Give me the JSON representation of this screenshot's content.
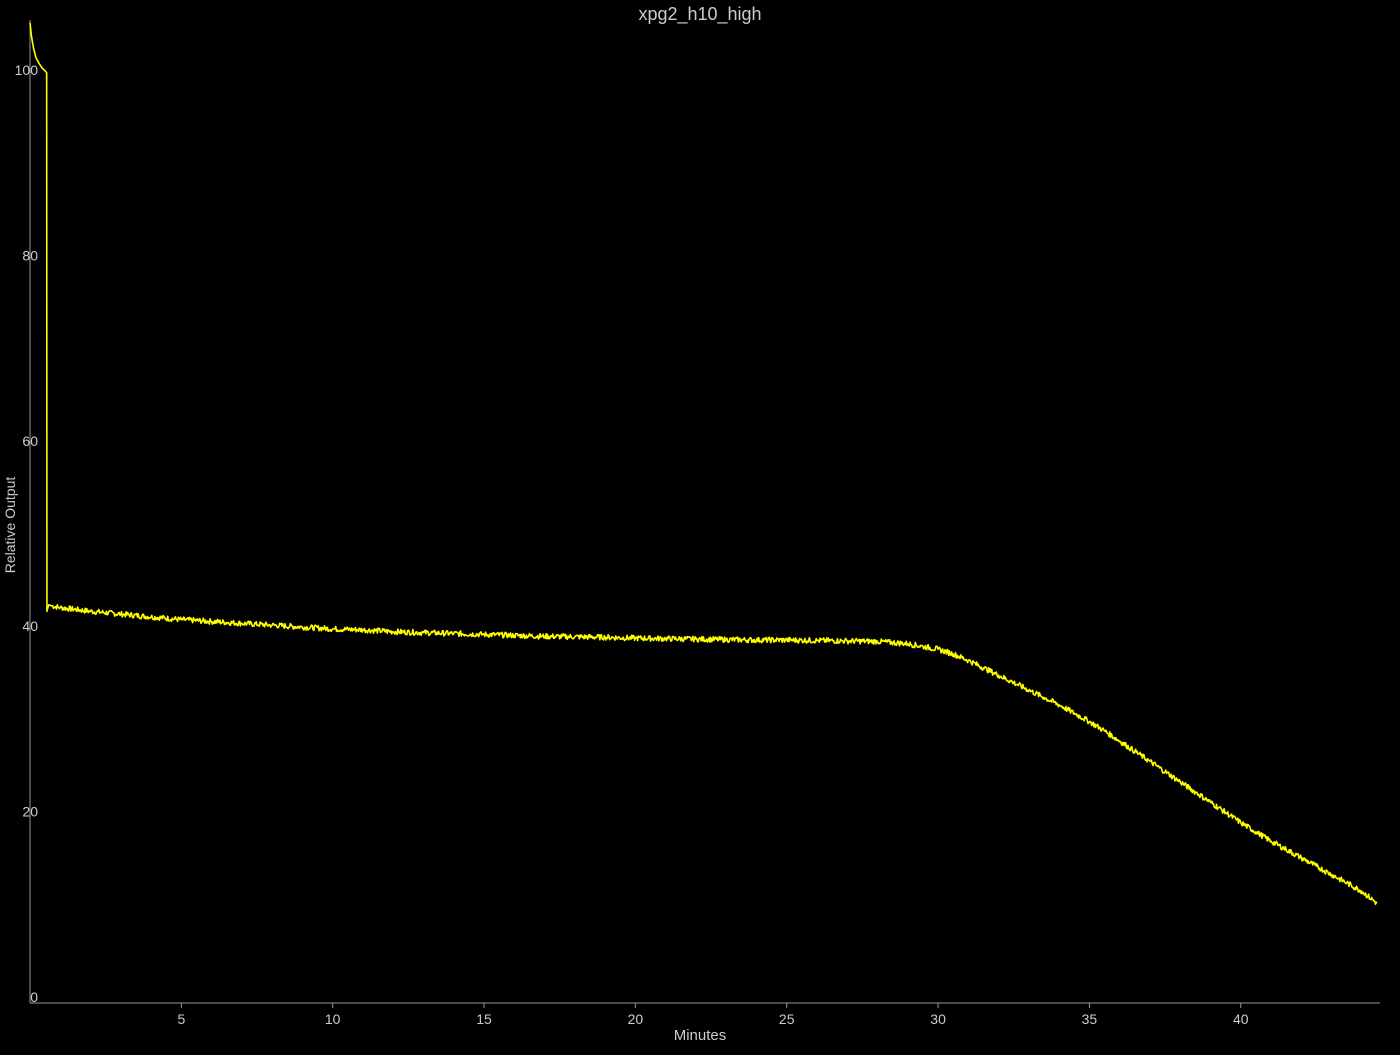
{
  "chart_data": {
    "type": "line",
    "title": "xpg2_h10_high",
    "xlabel": "Minutes",
    "ylabel": "Relative Output",
    "xlim": [
      0,
      44.6
    ],
    "ylim": [
      0,
      105
    ],
    "x_ticks": [
      5,
      10,
      15,
      20,
      25,
      30,
      35,
      40
    ],
    "y_ticks": [
      0,
      20,
      40,
      60,
      80,
      100
    ],
    "grid": false,
    "legend": "none",
    "colors": {
      "background": "#000000",
      "axis": "#999999",
      "text": "#cccccc",
      "series": "#ffff00"
    },
    "series": [
      {
        "x": [
          0.0,
          0.05,
          0.12,
          0.2,
          0.3,
          0.4,
          0.5,
          0.55,
          0.56,
          0.58,
          0.62,
          0.7,
          1,
          2,
          3,
          4,
          5,
          6,
          7,
          8,
          9,
          10,
          11,
          12,
          13,
          14,
          15,
          16,
          17,
          18,
          19,
          20,
          21,
          22,
          23,
          24,
          25,
          26,
          27,
          28,
          29,
          29.5,
          30,
          30.5,
          31,
          31.5,
          32,
          32.5,
          33,
          33.5,
          34,
          34.5,
          35,
          35.5,
          36,
          36.5,
          37,
          37.5,
          38,
          38.5,
          39,
          39.5,
          40,
          40.5,
          41,
          41.5,
          42,
          42.5,
          43,
          43.5,
          44,
          44.5
        ],
        "values": [
          105,
          103.5,
          102.2,
          101.2,
          100.6,
          100.1,
          99.8,
          99.6,
          41.5,
          41.8,
          42.2,
          42.1,
          41.9,
          41.5,
          41.2,
          40.9,
          40.6,
          40.4,
          40.2,
          40.0,
          39.8,
          39.6,
          39.5,
          39.3,
          39.2,
          39.1,
          39.0,
          38.9,
          38.8,
          38.75,
          38.7,
          38.6,
          38.55,
          38.5,
          38.45,
          38.4,
          38.4,
          38.35,
          38.3,
          38.25,
          38.0,
          37.7,
          37.4,
          36.9,
          36.2,
          35.4,
          34.6,
          33.8,
          33.0,
          32.2,
          31.4,
          30.5,
          29.6,
          28.6,
          27.5,
          26.4,
          25.3,
          24.2,
          23.1,
          22.0,
          20.9,
          19.8,
          18.7,
          17.7,
          16.7,
          15.8,
          14.9,
          14.0,
          13.1,
          12.2,
          11.3,
          10.0
        ]
      }
    ]
  }
}
